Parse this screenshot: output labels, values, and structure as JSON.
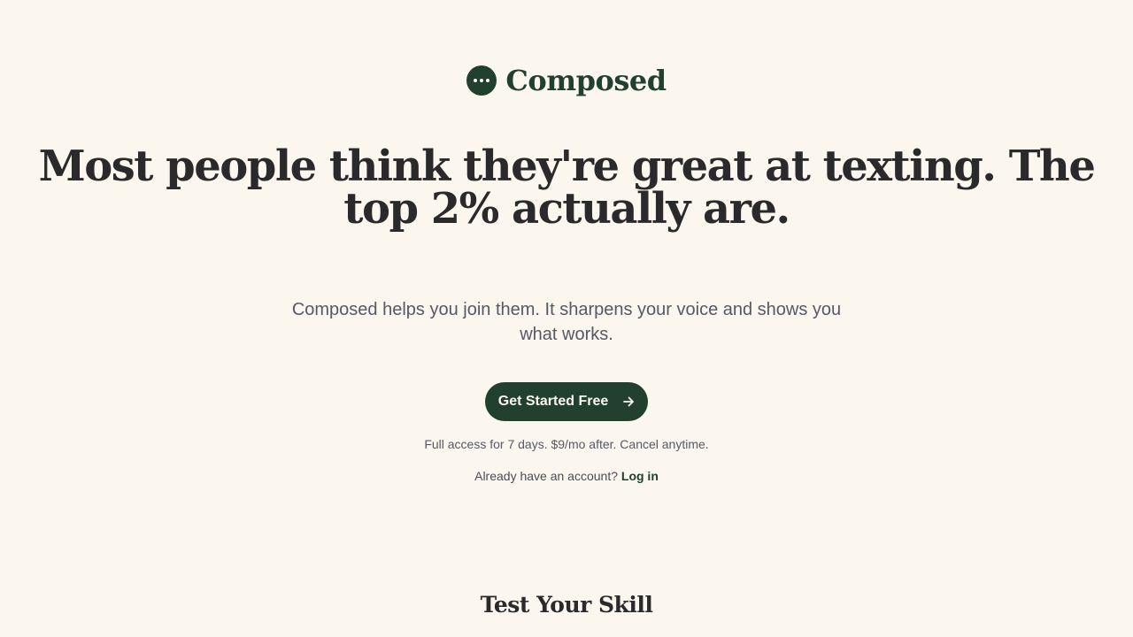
{
  "brand": {
    "name": "Composed",
    "logo_icon": "chat-bubble-dots-icon",
    "color": "#21402f"
  },
  "hero": {
    "headline": "Most people think they're great at texting. The top 2% actually are.",
    "subhead": "Composed helps you join them. It sharpens your voice and shows you what works.",
    "cta_label": "Get Started Free",
    "cta_icon": "arrow-right-icon",
    "fine_print": "Full access for 7 days. $9/mo after. Cancel anytime.",
    "login_prompt": "Already have an account?",
    "login_link": "Log in"
  },
  "next_section": {
    "title": "Test Your Skill"
  },
  "colors": {
    "background": "#fbf7ee",
    "text": "#2a2a2d",
    "muted": "#565866",
    "accent": "#21402f"
  }
}
